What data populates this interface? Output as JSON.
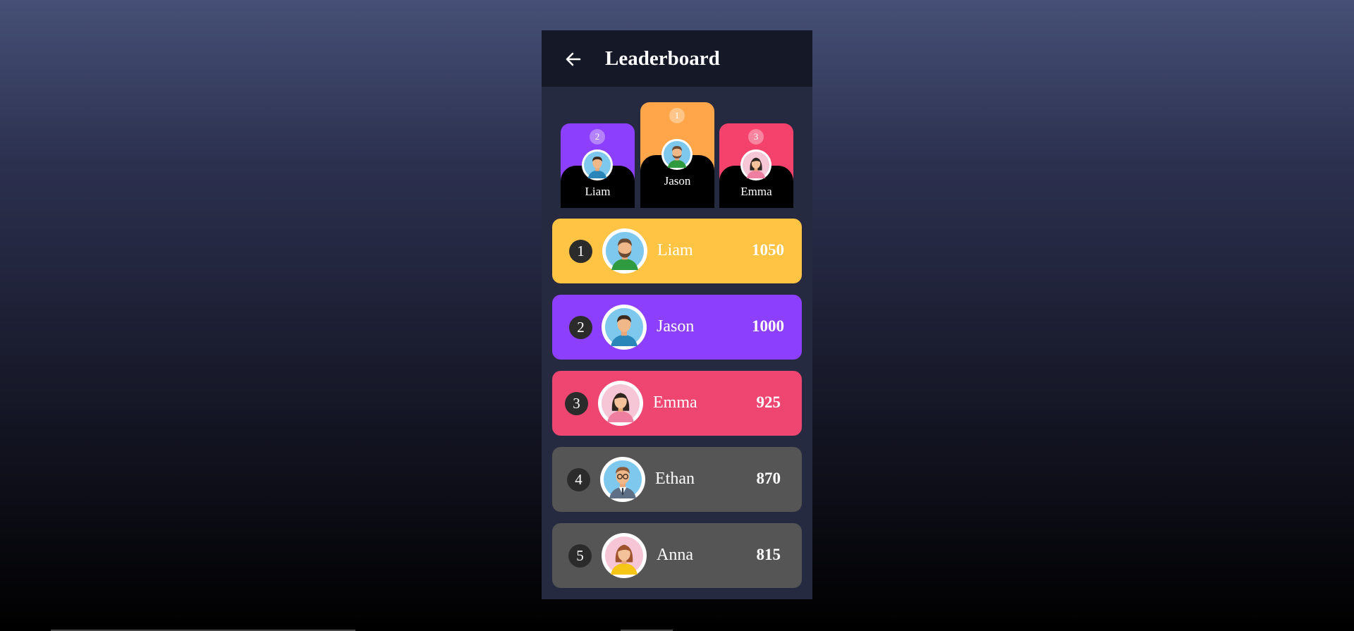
{
  "header": {
    "title": "Leaderboard",
    "back_icon": "arrow-left-icon"
  },
  "podium": [
    {
      "rank": "2",
      "name": "Liam",
      "color": "#8c3ffc",
      "avatar": "man-blue-shirt-avatar-icon"
    },
    {
      "rank": "1",
      "name": "Jason",
      "color": "#ffa64a",
      "avatar": "man-green-shirt-avatar-icon"
    },
    {
      "rank": "3",
      "name": "Emma",
      "color": "#f5426c",
      "avatar": "woman-pink-shirt-avatar-icon"
    }
  ],
  "rows": [
    {
      "rank": "1",
      "name": "Liam",
      "score": "1050",
      "color": "#ffc444",
      "avatar": "man-beard-green-shirt-avatar-icon"
    },
    {
      "rank": "2",
      "name": "Jason",
      "score": "1000",
      "color": "#8c3ffc",
      "avatar": "man-blue-shirt-avatar-icon"
    },
    {
      "rank": "3",
      "name": "Emma",
      "score": "925",
      "color": "#ee4671",
      "avatar": "woman-pink-shirt-avatar-icon"
    },
    {
      "rank": "4",
      "name": "Ethan",
      "score": "870",
      "color": "#555555",
      "avatar": "man-glasses-suit-avatar-icon"
    },
    {
      "rank": "5",
      "name": "Anna",
      "score": "815",
      "color": "#555555",
      "avatar": "woman-yellow-shirt-avatar-icon"
    }
  ]
}
